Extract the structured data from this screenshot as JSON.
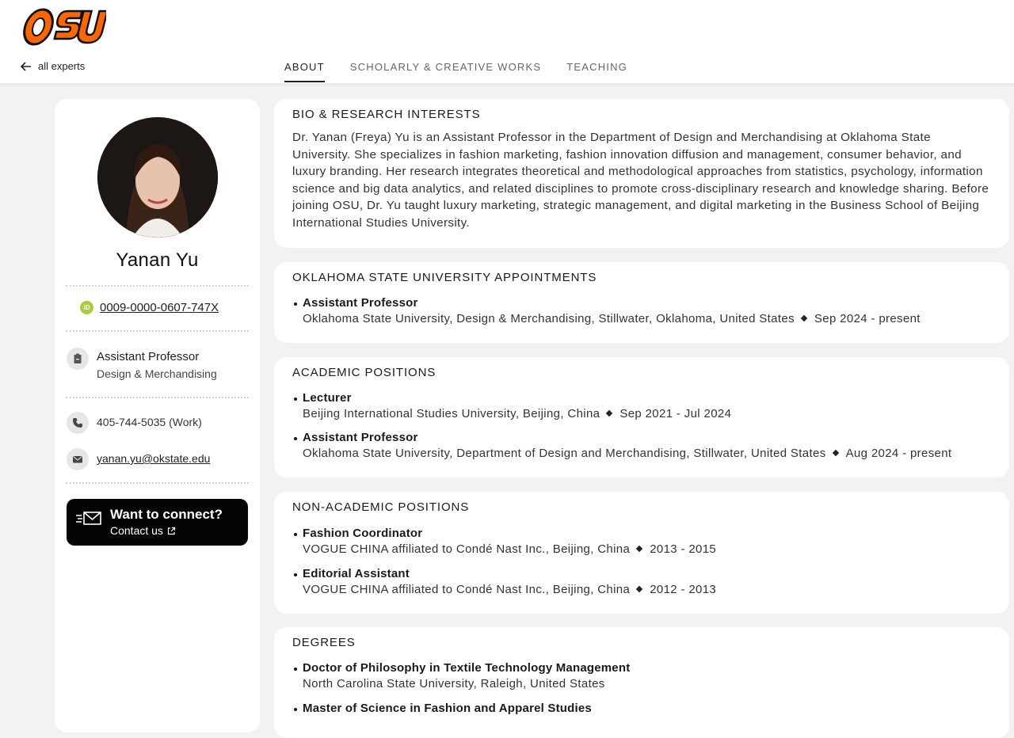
{
  "brand": {
    "logo_text": "OSU",
    "primary_color": "#ff6600"
  },
  "nav": {
    "back_label": "all experts",
    "tabs": [
      {
        "label": "ABOUT",
        "active": true
      },
      {
        "label": "SCHOLARLY & CREATIVE WORKS",
        "active": false
      },
      {
        "label": "TEACHING",
        "active": false
      }
    ]
  },
  "profile": {
    "name": "Yanan Yu",
    "orcid": "0009-0000-0607-747X",
    "position_title": "Assistant Professor",
    "department": "Design & Merchandising",
    "phone": "405-744-5035 (Work)",
    "email": "yanan.yu@okstate.edu",
    "connect_title": "Want to connect?",
    "connect_sub": "Contact us"
  },
  "bio": {
    "title": "BIO & RESEARCH INTERESTS",
    "text": "Dr. Yanan (Freya) Yu is an Assistant Professor in the Department of Design and Merchandising at Oklahoma State University. She specializes in fashion marketing, fashion innovation diffusion and management, consumer behavior, and luxury branding. Her research integrates theoretical and methodological approaches from statistics, psychology, information science and big data analytics, and related disciplines to promote cross-disciplinary research and knowledge sharing. Before joining OSU, Dr. Yu taught luxury marketing, strategic management, and digital marketing in the Business School of Beijing International Studies University."
  },
  "appointments": {
    "title": "OKLAHOMA STATE UNIVERSITY APPOINTMENTS",
    "items": [
      {
        "title": "Assistant Professor",
        "org": "Oklahoma State University, Design & Merchandising, Stillwater, Oklahoma, United States",
        "dates": "Sep 2024 - present"
      }
    ]
  },
  "academic": {
    "title": "ACADEMIC POSITIONS",
    "items": [
      {
        "title": "Lecturer",
        "org": "Beijing International Studies University, Beijing, China",
        "dates": "Sep 2021 - Jul 2024"
      },
      {
        "title": "Assistant Professor",
        "org": "Oklahoma State University, Department of Design and Merchandising, Stillwater, United States",
        "dates": "Aug 2024 - present"
      }
    ]
  },
  "nonacademic": {
    "title": "NON-ACADEMIC POSITIONS",
    "items": [
      {
        "title": "Fashion Coordinator",
        "org": "VOGUE CHINA affiliated to Condé Nast Inc., Beijing, China",
        "dates": "2013 - 2015"
      },
      {
        "title": "Editorial Assistant",
        "org": "VOGUE CHINA affiliated to Condé Nast Inc., Beijing, China",
        "dates": "2012 - 2013"
      }
    ]
  },
  "degrees": {
    "title": "DEGREES",
    "items": [
      {
        "title": "Doctor of Philosophy in Textile Technology Management",
        "org": "North Carolina State University, Raleigh, United States"
      },
      {
        "title": "Master of Science in Fashion and Apparel Studies"
      }
    ]
  }
}
